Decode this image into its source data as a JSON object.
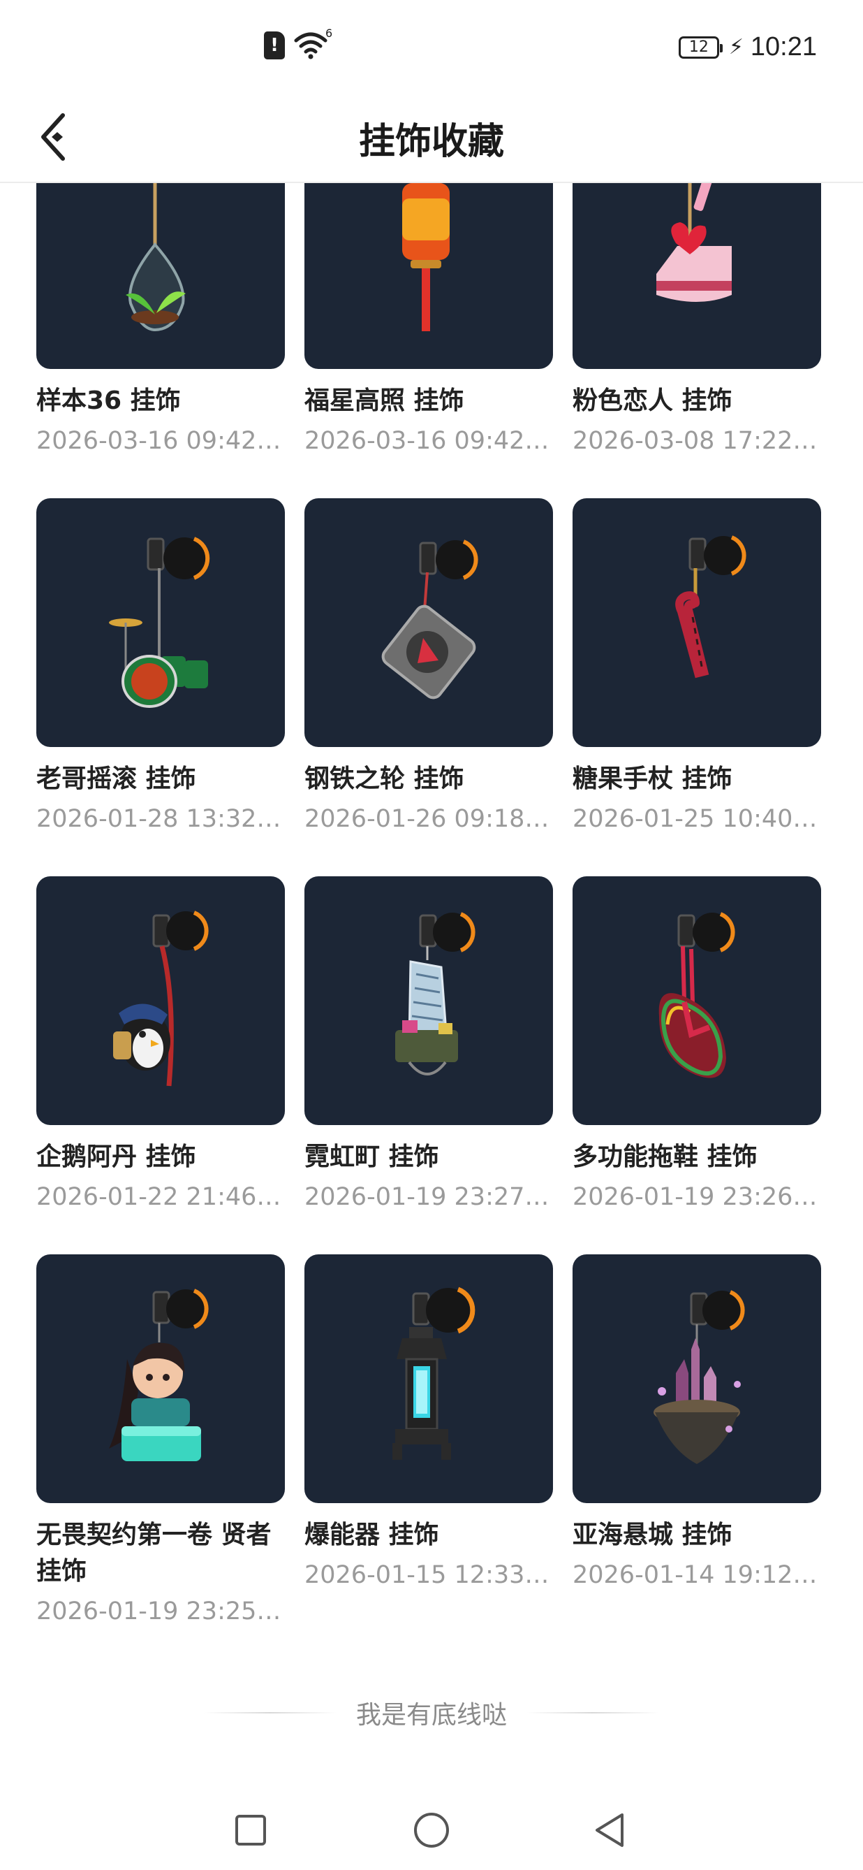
{
  "status_bar": {
    "sim_label": "!",
    "wifi_label": "6",
    "battery_level": "12",
    "time": "10:21"
  },
  "header": {
    "title": "挂饰收藏"
  },
  "items": [
    {
      "name": "样本36 挂饰",
      "date": "2026-03-16 09:42:..."
    },
    {
      "name": "福星高照 挂饰",
      "date": "2026-03-16 09:42:..."
    },
    {
      "name": "粉色恋人 挂饰",
      "date": "2026-03-08 17:22:..."
    },
    {
      "name": "老哥摇滚 挂饰",
      "date": "2026-01-28 13:32:..."
    },
    {
      "name": "钢铁之轮 挂饰",
      "date": "2026-01-26 09:18:..."
    },
    {
      "name": "糖果手杖 挂饰",
      "date": "2026-01-25 10:40:..."
    },
    {
      "name": "企鹅阿丹 挂饰",
      "date": "2026-01-22 21:46:..."
    },
    {
      "name": "霓虹町 挂饰",
      "date": "2026-01-19 23:27:..."
    },
    {
      "name": "多功能拖鞋 挂饰",
      "date": "2026-01-19 23:26:..."
    },
    {
      "name": "无畏契约第一卷 贤者 挂饰",
      "date": "2026-01-19 23:25:..."
    },
    {
      "name": "爆能器 挂饰",
      "date": "2026-01-15 12:33:..."
    },
    {
      "name": "亚海悬城 挂饰",
      "date": "2026-01-14 19:12:..."
    }
  ],
  "footer": {
    "end_text": "我是有底线哒"
  },
  "colors": {
    "thumb_bg": "#1c2636",
    "accent_orange": "#f08a1a",
    "date_gray": "#9a9a9a"
  }
}
